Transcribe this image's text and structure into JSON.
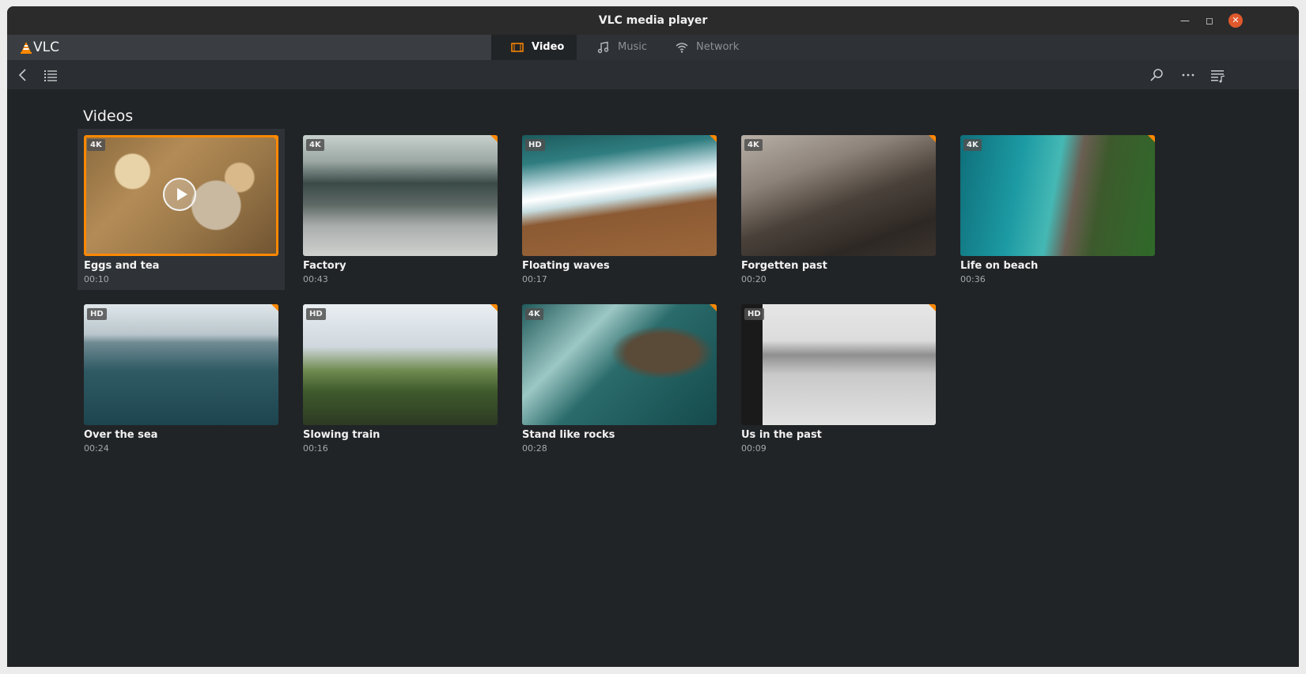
{
  "window": {
    "title": "VLC media player"
  },
  "brand": {
    "name": "VLC"
  },
  "tabs": [
    {
      "label": "Video",
      "icon": "film-icon",
      "active": true
    },
    {
      "label": "Music",
      "icon": "music-note-icon",
      "active": false
    },
    {
      "label": "Network",
      "icon": "wifi-icon",
      "active": false
    }
  ],
  "toolbar": {
    "left": [
      "back-arrow-icon",
      "list-view-icon"
    ],
    "right": [
      "search-icon",
      "more-options-icon",
      "playlist-icon"
    ]
  },
  "section": {
    "heading": "Videos"
  },
  "colors": {
    "accent": "#ff8800",
    "background": "#212427",
    "close_button": "#e0582c"
  },
  "videos": [
    {
      "title": "Eggs and tea",
      "duration": "00:10",
      "badge": "4K",
      "selected": true
    },
    {
      "title": "Factory",
      "duration": "00:43",
      "badge": "4K",
      "selected": false
    },
    {
      "title": "Floating waves",
      "duration": "00:17",
      "badge": "HD",
      "selected": false
    },
    {
      "title": "Forgetten past",
      "duration": "00:20",
      "badge": "4K",
      "selected": false
    },
    {
      "title": "Life on beach",
      "duration": "00:36",
      "badge": "4K",
      "selected": false
    },
    {
      "title": "Over the sea",
      "duration": "00:24",
      "badge": "HD",
      "selected": false
    },
    {
      "title": "Slowing train",
      "duration": "00:16",
      "badge": "HD",
      "selected": false
    },
    {
      "title": "Stand like rocks",
      "duration": "00:28",
      "badge": "4K",
      "selected": false
    },
    {
      "title": "Us in the past",
      "duration": "00:09",
      "badge": "HD",
      "selected": false
    }
  ]
}
